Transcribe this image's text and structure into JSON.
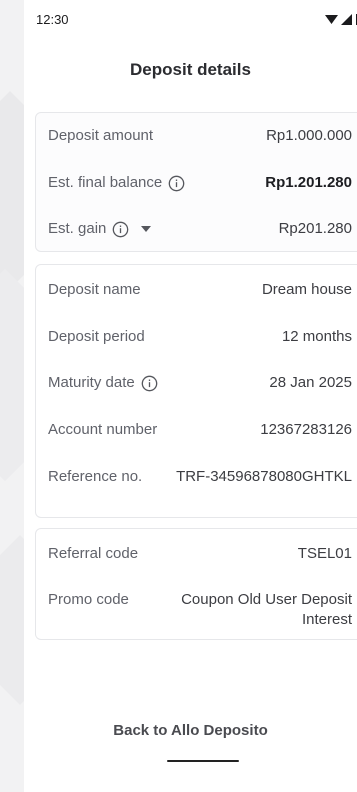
{
  "status_bar": {
    "time": "12:30",
    "icons": [
      "wifi-icon",
      "signal-icon",
      "battery-icon"
    ]
  },
  "header": {
    "title": "Deposit details"
  },
  "summary": {
    "deposit_amount_label": "Deposit amount",
    "deposit_amount_value": "Rp1.000.000",
    "est_final_balance_label": "Est. final balance",
    "est_final_balance_value": "Rp1.201.280",
    "est_gain_label": "Est. gain",
    "est_gain_value": "Rp201.280"
  },
  "details": {
    "deposit_name_label": "Deposit name",
    "deposit_name_value": "Dream house",
    "deposit_period_label": "Deposit period",
    "deposit_period_value": "12 months",
    "maturity_date_label": "Maturity date",
    "maturity_date_value": "28 Jan 2025",
    "account_number_label": "Account number",
    "account_number_value": "12367283126",
    "reference_no_label": "Reference no.",
    "reference_no_value": "TRF-34596878080GHTKL"
  },
  "codes": {
    "referral_code_label": "Referral code",
    "referral_code_value": "TSEL01",
    "promo_code_label": "Promo code",
    "promo_code_value": "Coupon Old User Deposit Interest"
  },
  "footer": {
    "back_label": "Back to Allo Deposito"
  },
  "colors": {
    "background": "#ffffff",
    "page_backdrop": "#f2f2f3",
    "card_border": "#e6e7ea",
    "text_primary": "#1d1e22",
    "text_secondary": "#60626a"
  }
}
